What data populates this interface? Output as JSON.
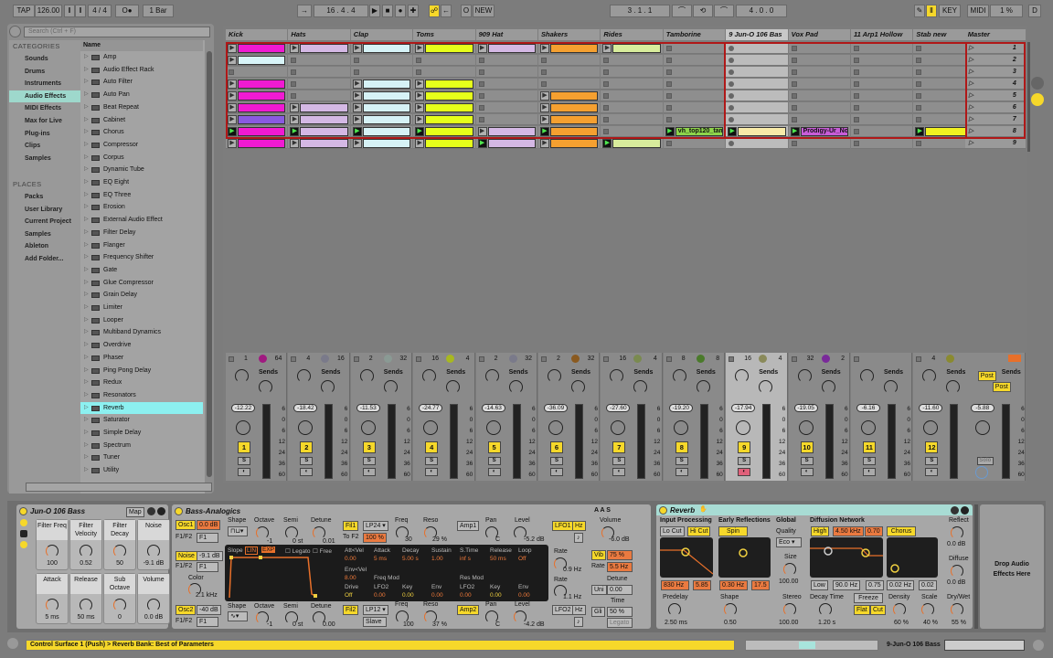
{
  "transport": {
    "tap": "TAP",
    "tempo": "126.00",
    "signature": "4 / 4",
    "metronome": "O●",
    "quantize": "1 Bar",
    "position": "16 .  4 .  4",
    "new": "NEW",
    "loop_start": "3 .  1 .  1",
    "loop_length": "4 .  0 .  0",
    "key": "KEY",
    "midi": "MIDI",
    "cpu": "1 %",
    "d": "D"
  },
  "browser": {
    "search_placeholder": "Search (Ctrl + F)",
    "categories_title": "CATEGORIES",
    "categories": [
      "Sounds",
      "Drums",
      "Instruments",
      "Audio Effects",
      "MIDI Effects",
      "Max for Live",
      "Plug-ins",
      "Clips",
      "Samples"
    ],
    "selected_category": 3,
    "places_title": "PLACES",
    "places": [
      "Packs",
      "User Library",
      "Current Project",
      "Samples",
      "Ableton",
      "Add Folder..."
    ],
    "name_header": "Name",
    "items": [
      "Amp",
      "Audio Effect Rack",
      "Auto Filter",
      "Auto Pan",
      "Beat Repeat",
      "Cabinet",
      "Chorus",
      "Compressor",
      "Corpus",
      "Dynamic Tube",
      "EQ Eight",
      "EQ Three",
      "Erosion",
      "External Audio Effect",
      "Filter Delay",
      "Flanger",
      "Frequency Shifter",
      "Gate",
      "Glue Compressor",
      "Grain Delay",
      "Limiter",
      "Looper",
      "Multiband Dynamics",
      "Overdrive",
      "Phaser",
      "Ping Pong Delay",
      "Redux",
      "Resonators",
      "Reverb",
      "Saturator",
      "Simple Delay",
      "Spectrum",
      "Tuner",
      "Utility"
    ],
    "selected_item": 28
  },
  "tracks": [
    {
      "name": "Kick",
      "color": "#f01ad2",
      "slots": [
        "c",
        "c:#d8f4f8",
        "e",
        "c",
        "c",
        "c",
        "c:#8a5ae0",
        "p",
        "c"
      ],
      "in": "1",
      "out": "64",
      "knob": "#a01a80",
      "vol": "-12.22",
      "num": "1",
      "arm": "off"
    },
    {
      "name": "Hats",
      "color": "#d4b8e4",
      "slots": [
        "c",
        "e",
        "e",
        "e",
        "e",
        "c",
        "c",
        "p",
        "c"
      ],
      "in": "4",
      "out": "16",
      "knob": "#7a7a8a",
      "vol": "-18.42",
      "num": "2",
      "arm": "off"
    },
    {
      "name": "Clap",
      "color": "#d6f2f6",
      "slots": [
        "c",
        "e",
        "e",
        "c",
        "c",
        "c",
        "c",
        "p",
        "c"
      ],
      "in": "2",
      "out": "32",
      "knob": "#8a9a94",
      "vol": "-11.53",
      "num": "3",
      "arm": "off"
    },
    {
      "name": "Toms",
      "color": "#e6ff1a",
      "slots": [
        "c",
        "e",
        "e",
        "c",
        "c",
        "c",
        "c",
        "p",
        "c"
      ],
      "in": "16",
      "out": "4",
      "knob": "#a8b820",
      "vol": "-24.77",
      "num": "4",
      "arm": "off"
    },
    {
      "name": "909 Hat",
      "color": "#d4b8e4",
      "slots": [
        "c",
        "e",
        "e",
        "e",
        "e",
        "e",
        "e",
        "c",
        "p"
      ],
      "in": "2",
      "out": "32",
      "knob": "#7a7a8a",
      "vol": "-14.63",
      "num": "5",
      "arm": "off"
    },
    {
      "name": "Shakers",
      "color": "#f5a030",
      "slots": [
        "c",
        "e",
        "e",
        "e",
        "c",
        "c",
        "c",
        "p",
        "c"
      ],
      "in": "2",
      "out": "32",
      "knob": "#8a5a20",
      "vol": "-36.09",
      "num": "6",
      "arm": "off"
    },
    {
      "name": "Rides",
      "color": "#d8ec9c",
      "slots": [
        "c",
        "e",
        "e",
        "e",
        "e",
        "e",
        "e",
        "e",
        "p"
      ],
      "in": "16",
      "out": "4",
      "knob": "#7a8a50",
      "vol": "-27.60",
      "num": "7",
      "arm": "off"
    },
    {
      "name": "Tamborine",
      "color": "#8ed44a",
      "slots": [
        "e",
        "e",
        "e",
        "e",
        "e",
        "e",
        "e",
        "p",
        "e"
      ],
      "clip_name": "vh_top120_tamb",
      "in": "8",
      "out": "8",
      "knob": "#4a7a2a",
      "vol": "-19.20",
      "num": "8",
      "arm": "off"
    },
    {
      "name": "9 Jun-O 106 Bas",
      "color": "#f8eaa8",
      "slots": [
        "r",
        "r",
        "r",
        "r",
        "r",
        "r",
        "r",
        "p",
        "r"
      ],
      "in": "16",
      "out": "4",
      "knob": "#8a8a5a",
      "vol": "-17.94",
      "num": "9",
      "arm": "on",
      "selected": true
    },
    {
      "name": "Vox Pad",
      "color": "#c85cd8",
      "slots": [
        "e",
        "e",
        "e",
        "e",
        "e",
        "e",
        "e",
        "p",
        "e"
      ],
      "clip_name": "Prodigy-Ur_No_",
      "in": "32",
      "out": "2",
      "knob": "#7a2a9a",
      "vol": "-19.05",
      "num": "10",
      "arm": "off"
    },
    {
      "name": "11 Arp1 Hollow",
      "color": "#999999",
      "slots": [
        "e",
        "e",
        "e",
        "e",
        "e",
        "e",
        "e",
        "e",
        "e"
      ],
      "in": "",
      "out": "",
      "knob": "",
      "vol": "-6.16",
      "num": "11",
      "arm": "off"
    },
    {
      "name": "Stab new",
      "color": "#f0f020",
      "slots": [
        "e",
        "e",
        "e",
        "e",
        "e",
        "e",
        "e",
        "p",
        "e"
      ],
      "in": "4",
      "out": "1",
      "knob": "#8a8a30",
      "vol": "-11.60",
      "num": "12",
      "arm": "off"
    }
  ],
  "master": {
    "name": "Master",
    "scenes": [
      "1",
      "2",
      "3",
      "4",
      "5",
      "6",
      "7",
      "8",
      "9"
    ],
    "vol": "-5.88",
    "post": "Post",
    "solo": "Solo"
  },
  "mixer": {
    "sends": "Sends",
    "solo": "S",
    "scale": [
      "6",
      "0",
      "6",
      "12",
      "24",
      "36",
      "60"
    ]
  },
  "rack": {
    "title": "Jun-O 106 Bass",
    "map": "Map",
    "macros": [
      {
        "label": "Filter Freq",
        "value": "100"
      },
      {
        "label": "Filter Velocity",
        "value": "0.52"
      },
      {
        "label": "Filter Decay",
        "value": "50"
      },
      {
        "label": "Noise",
        "value": "-9.1 dB"
      },
      {
        "label": "Attack",
        "value": "5 ms"
      },
      {
        "label": "Release",
        "value": "50 ms"
      },
      {
        "label": "Sub Octave",
        "value": "0"
      },
      {
        "label": "Volume",
        "value": "0.0 dB"
      }
    ]
  },
  "analog": {
    "title": "Bass-Analogics",
    "aas": "A A S",
    "osc1": "Osc1",
    "osc1_level": "0.0 dB",
    "f1f2": "F1/F2",
    "f1": "F1",
    "shape": "Shape",
    "octave": "Octave",
    "semi": "Semi",
    "detune": "Detune",
    "osc1_oct": "-1",
    "osc1_semi": "0 st",
    "osc1_det": "0.01",
    "noise": "Noise",
    "noise_level": "-9.1 dB",
    "color": "Color",
    "color_val": "2.1 kHz",
    "osc2": "Osc2",
    "osc2_level": "-40 dB",
    "osc2_oct": "-1",
    "osc2_semi": "0 st",
    "osc2_det": "0.00",
    "env": {
      "slope": "Slope",
      "lin": "LIN",
      "exp": "EXP",
      "legato": "Legato",
      "free": "Free",
      "labels1": [
        "Att<Vel",
        "Attack",
        "Decay",
        "Sustain",
        "S.Time",
        "Release",
        "Loop"
      ],
      "values1": [
        "0.00",
        "5 ms",
        "5.00 s",
        "1.00",
        "inf s",
        "50 ms",
        "Off"
      ],
      "envvel": "Env<Vel",
      "envvel_val": "8.00",
      "freqmod": "Freq Mod",
      "resmod": "Res Mod",
      "labels2": [
        "Drive",
        "LFO2",
        "Key",
        "Env",
        "LFO2",
        "Key",
        "Env"
      ],
      "values2": [
        "Off",
        "0.00",
        "0.00",
        "0.00",
        "0.00",
        "0.00",
        "0.00"
      ]
    },
    "fil1": "Fil1",
    "fil1_type": "LP24",
    "tof2": "To F2",
    "tof2_val": "100 %",
    "freq": "Freq",
    "reso": "Reso",
    "fil1_freq": "30",
    "fil1_reso": "29 %",
    "fil2": "Fil2",
    "fil2_type": "LP12",
    "slave": "Slave",
    "fil2_freq": "100",
    "fil2_reso": "37 %",
    "amp1": "Amp1",
    "amp2": "Amp2",
    "pan": "Pan",
    "level": "Level",
    "amp1_pan": "C",
    "amp1_level": "-5.2 dB",
    "amp2_pan": "C",
    "amp2_level": "-4.2 dB",
    "lfo1": "LFO1",
    "lfo2": "LFO2",
    "hz": "Hz",
    "rate": "Rate",
    "lfo1_rate": "0.9 Hz",
    "lfo2_rate": "1.1 Hz",
    "volume": "Volume",
    "volume_val": "-6.0 dB",
    "vib": "Vib",
    "vib_val": "75 %",
    "vib_rate": "5.5 Hz",
    "uni": "Uni",
    "uni_det": "0.00",
    "time": "Time",
    "gli": "Gli",
    "gli_val": "50 %",
    "legato": "Legato"
  },
  "reverb": {
    "title": "Reverb",
    "input": "Input Processing",
    "locut": "Lo Cut",
    "hicut": "Hi Cut",
    "in_freq": "830 Hz",
    "in_q": "5.85",
    "early": "Early Reflections",
    "spin": "Spin",
    "er_freq": "0.30 Hz",
    "er_amt": "17.5",
    "global": "Global",
    "quality": "Quality",
    "quality_val": "Eco",
    "size": "Size",
    "size_val": "100.00",
    "stereo": "Stereo",
    "stereo_val": "100.00",
    "diffusion": "Diffusion Network",
    "high": "High",
    "high_freq": "4.50 kHz",
    "high_amt": "0.70",
    "chorus": "Chorus",
    "low": "Low",
    "low_freq": "90.0 Hz",
    "low_amt": "0.75",
    "ch_rate": "0.02 Hz",
    "ch_amt": "0.02",
    "predelay": "Predelay",
    "predelay_val": "2.50 ms",
    "shape": "Shape",
    "shape_val": "0.50",
    "decay": "Decay Time",
    "decay_val": "1.20 s",
    "freeze": "Freeze",
    "flat": "Flat",
    "cut": "Cut",
    "density": "Density",
    "density_val": "60 %",
    "scale": "Scale",
    "scale_val": "40 %",
    "reflect": "Reflect",
    "reflect_val": "0.0 dB",
    "diffuse": "Diffuse",
    "diffuse_val": "0.0 dB",
    "drywet": "Dry/Wet",
    "drywet_val": "55 %"
  },
  "drop_zone": "Drop Audio Effects Here",
  "status": {
    "message": "Control Surface 1 (Push) > Reverb Bank: Best of Parameters",
    "track": "9-Jun-O 106 Bass"
  },
  "colors": {
    "accent": "#f6d82a",
    "selection": "#9ed8cc",
    "record": "#b01818"
  }
}
